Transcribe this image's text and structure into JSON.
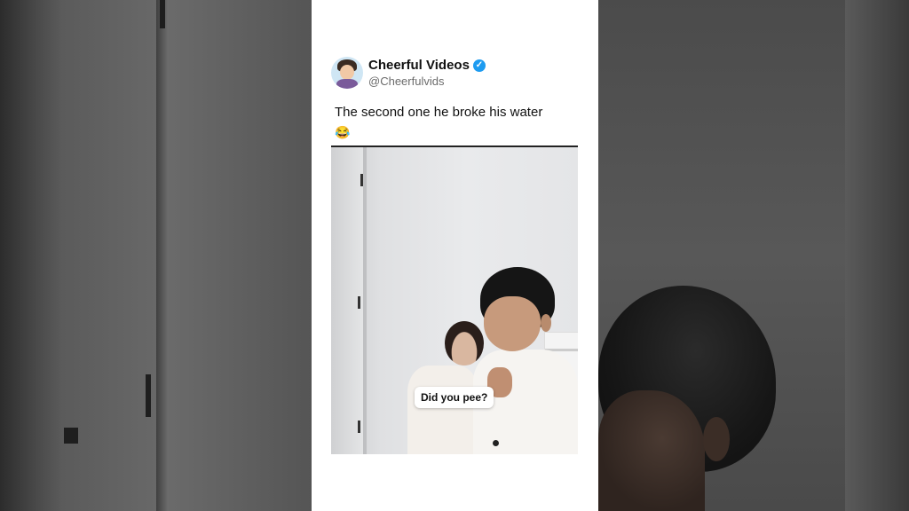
{
  "post": {
    "account_name": "Cheerful Videos",
    "handle": "@Cheerfulvids",
    "verified_icon": "verified-badge-icon",
    "caption": "The second one he broke his water",
    "caption_emoji": "😂"
  },
  "video": {
    "overlay_text": "Did you pee?"
  },
  "colors": {
    "card_bg": "#ffffff",
    "verified": "#1d9bf0",
    "handle": "#6b6b6b",
    "background": "#3a3a3a"
  }
}
